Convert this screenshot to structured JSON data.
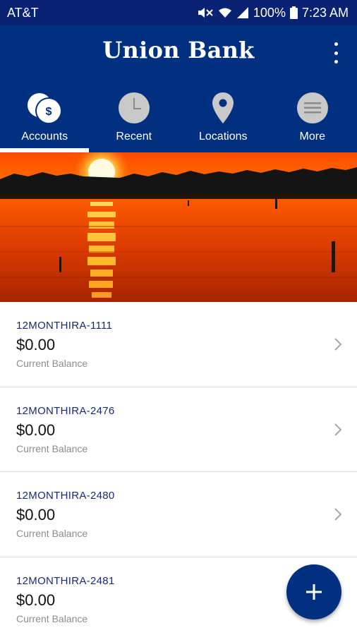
{
  "status_bar": {
    "carrier": "AT&T",
    "battery": "100%",
    "time": "7:23 AM"
  },
  "header": {
    "title": "Union Bank",
    "menu_icon": "more-vert-icon"
  },
  "tabs": [
    {
      "label": "Accounts",
      "icon": "coins-icon",
      "selected": true
    },
    {
      "label": "Recent",
      "icon": "clock-icon",
      "selected": false
    },
    {
      "label": "Locations",
      "icon": "map-pin-icon",
      "selected": false
    },
    {
      "label": "More",
      "icon": "menu-icon",
      "selected": false
    }
  ],
  "accounts": [
    {
      "name": "12MONTHIRA-1111",
      "balance": "$0.00",
      "caption": "Current Balance"
    },
    {
      "name": "12MONTHIRA-2476",
      "balance": "$0.00",
      "caption": "Current Balance"
    },
    {
      "name": "12MONTHIRA-2480",
      "balance": "$0.00",
      "caption": "Current Balance"
    },
    {
      "name": "12MONTHIRA-2481",
      "balance": "$0.00",
      "caption": "Current Balance"
    }
  ],
  "fab": {
    "label": "+",
    "icon": "add-icon"
  },
  "colors": {
    "brand_blue": "#00307f",
    "status_blue": "#0a2273",
    "account_name": "#1a2a72",
    "caption_gray": "#8c8c8c"
  }
}
